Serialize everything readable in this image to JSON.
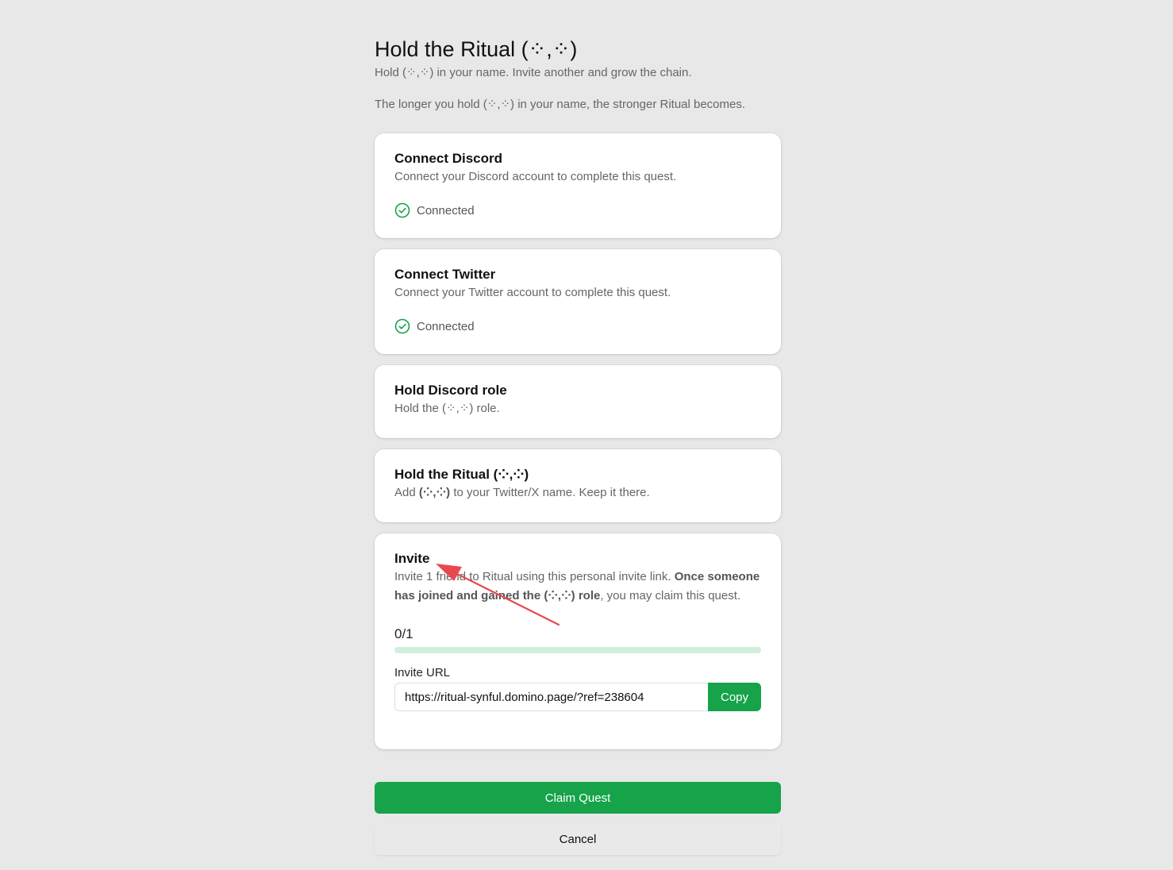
{
  "header": {
    "title": "Hold the Ritual (⁘,⁘)",
    "subtitle": "Hold (⁘,⁘) in your name. Invite another and grow the chain.",
    "subtitle2": "The longer you hold (⁘,⁘) in your name, the stronger Ritual becomes."
  },
  "quests": {
    "discord": {
      "title": "Connect Discord",
      "desc": "Connect your Discord account to complete this quest.",
      "status": "Connected"
    },
    "twitter": {
      "title": "Connect Twitter",
      "desc": "Connect your Twitter account to complete this quest.",
      "status": "Connected"
    },
    "role": {
      "title": "Hold Discord role",
      "desc": "Hold the (⁘,⁘) role."
    },
    "ritual": {
      "title": "Hold the Ritual (⁘,⁘)",
      "desc_pre": "Add ",
      "desc_bold": "(⁘,⁘)",
      "desc_post": " to your Twitter/X name. Keep it there."
    },
    "invite": {
      "title": "Invite",
      "desc_pre": "Invite 1 friend to Ritual using this personal invite link. ",
      "desc_bold": "Once someone has joined and gained the (⁘,⁘) role",
      "desc_post": ", you may claim this quest.",
      "progress_label": "0/1",
      "progress_fraction": 0,
      "url_label": "Invite URL",
      "url_value": "https://ritual-synful.domino.page/?ref=238604",
      "copy_label": "Copy"
    }
  },
  "actions": {
    "claim_label": "Claim Quest",
    "cancel_label": "Cancel"
  },
  "colors": {
    "accent": "#16a34a",
    "track": "#d3efdc",
    "arrow": "#e8494f"
  }
}
